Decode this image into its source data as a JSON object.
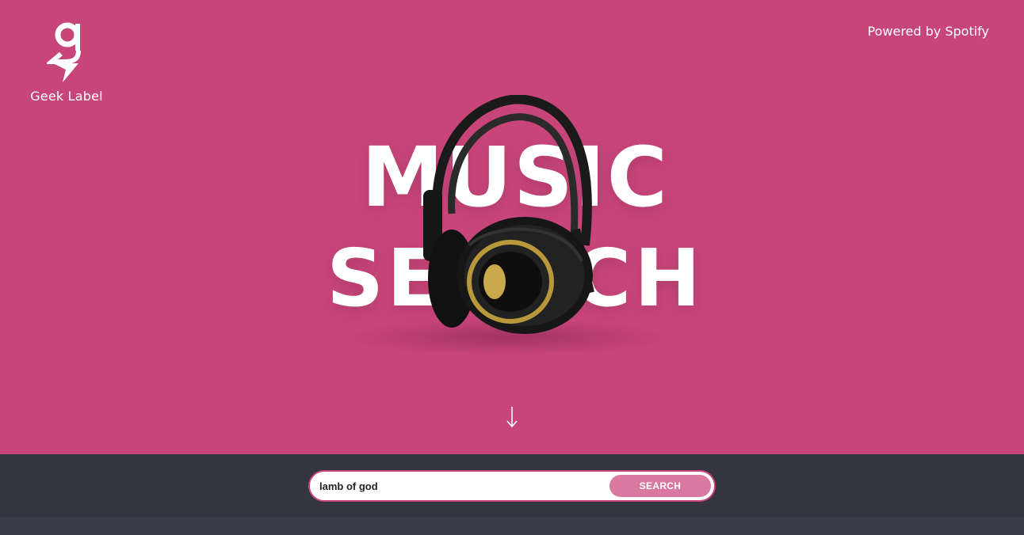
{
  "header": {
    "logo_text": "Geek Label",
    "powered_by": "Powered by Spotify"
  },
  "hero": {
    "title_line1": "MUSIC",
    "title_line2": "SEARCH",
    "scroll_icon": "arrow-down-icon",
    "headphones_icon": "headphones-image"
  },
  "search": {
    "value": "lamb of god",
    "placeholder": "",
    "button_label": "SEARCH"
  },
  "colors": {
    "hero_background": "#c8457a",
    "search_bar_background": "#343541",
    "button_background": "#d9799f",
    "text": "#ffffff"
  }
}
